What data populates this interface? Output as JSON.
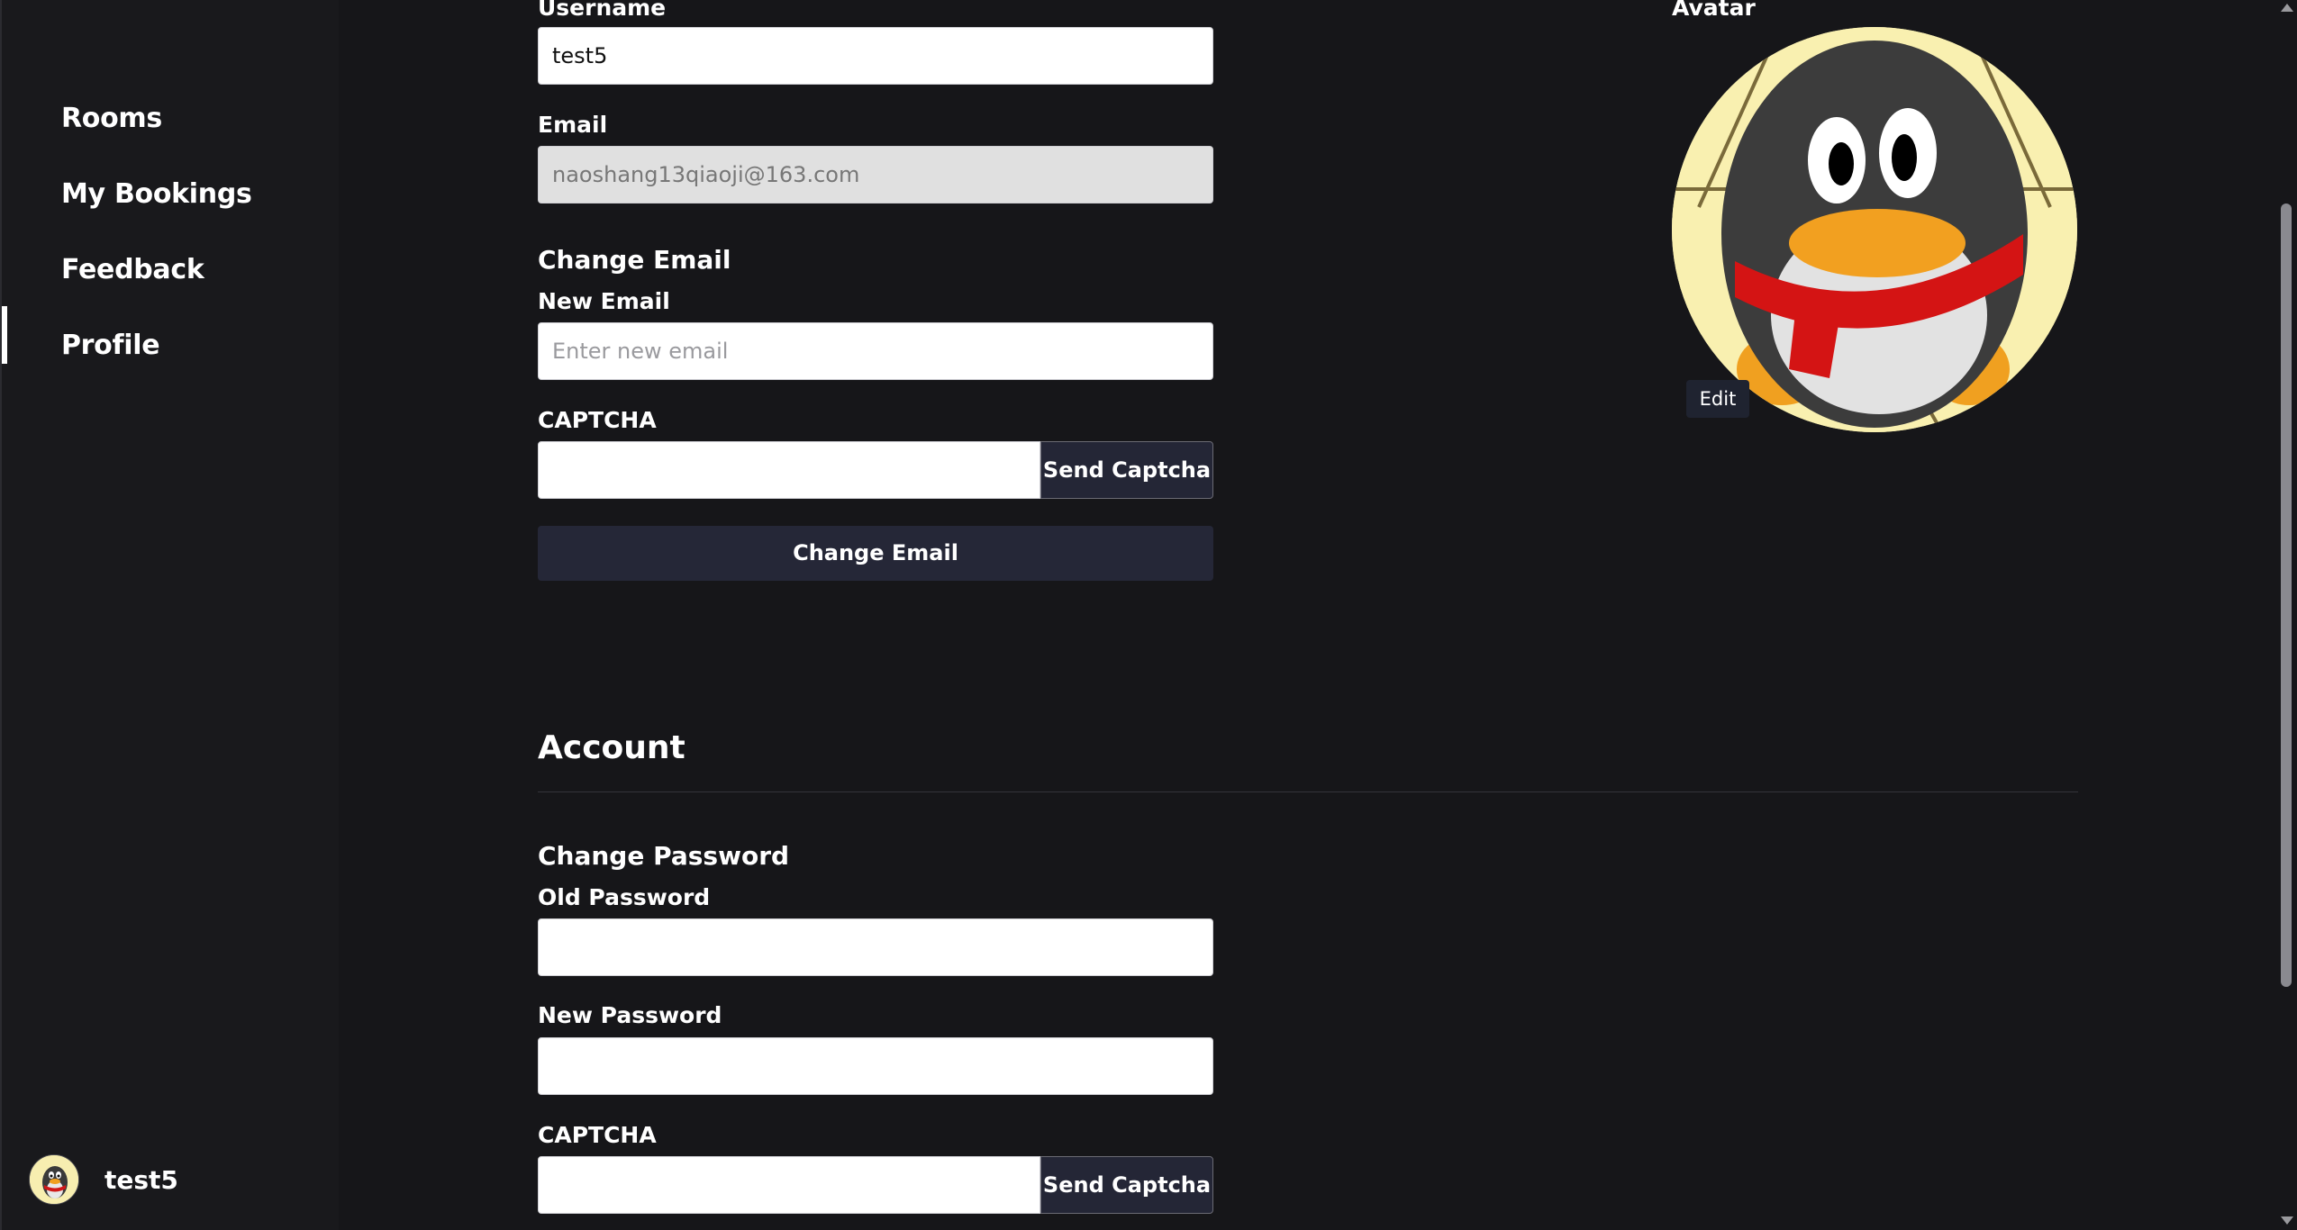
{
  "sidebar": {
    "items": [
      {
        "label": "Rooms"
      },
      {
        "label": "My Bookings"
      },
      {
        "label": "Feedback"
      },
      {
        "label": "Profile",
        "active": true
      }
    ],
    "user": {
      "name": "test5"
    }
  },
  "profile": {
    "username_label": "Username",
    "username_value": "test5",
    "email_label": "Email",
    "email_value": "naoshang13qiaoji@163.com",
    "avatar_label": "Avatar",
    "avatar_edit": "Edit"
  },
  "change_email": {
    "heading": "Change Email",
    "new_email_label": "New Email",
    "new_email_placeholder": "Enter new email",
    "captcha_label": "CAPTCHA",
    "send_captcha": "Send Captcha",
    "submit": "Change Email"
  },
  "account": {
    "title": "Account",
    "change_password": {
      "heading": "Change Password",
      "old_label": "Old Password",
      "new_label": "New Password",
      "captcha_label": "CAPTCHA",
      "send_captcha": "Send Captcha"
    }
  },
  "colors": {
    "background": "#161619",
    "sidebar": "#19191c",
    "button": "#252737",
    "avatar_bg": "#f9f0b0"
  }
}
